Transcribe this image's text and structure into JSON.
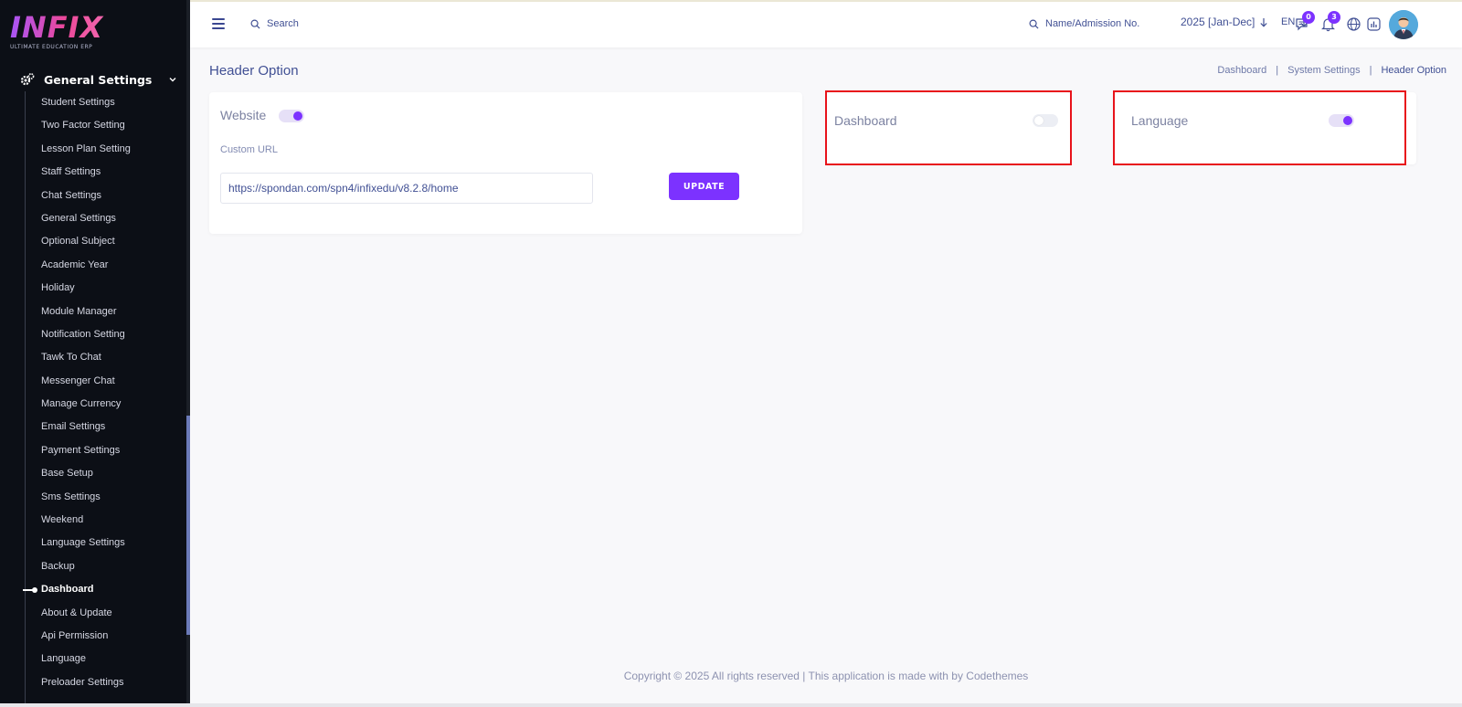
{
  "brand": {
    "logo_text": "INFIX",
    "logo_subtitle": "ULTIMATE EDUCATION ERP"
  },
  "sidebar": {
    "group_title": "General Settings",
    "items": [
      {
        "label": "Student Settings"
      },
      {
        "label": "Two Factor Setting"
      },
      {
        "label": "Lesson Plan Setting"
      },
      {
        "label": "Staff Settings"
      },
      {
        "label": "Chat Settings"
      },
      {
        "label": "General Settings"
      },
      {
        "label": "Optional Subject"
      },
      {
        "label": "Academic Year"
      },
      {
        "label": "Holiday"
      },
      {
        "label": "Module Manager"
      },
      {
        "label": "Notification Setting"
      },
      {
        "label": "Tawk To Chat"
      },
      {
        "label": "Messenger Chat"
      },
      {
        "label": "Manage Currency"
      },
      {
        "label": "Email Settings"
      },
      {
        "label": "Payment Settings"
      },
      {
        "label": "Base Setup"
      },
      {
        "label": "Sms Settings"
      },
      {
        "label": "Weekend"
      },
      {
        "label": "Language Settings"
      },
      {
        "label": "Backup"
      },
      {
        "label": "Dashboard"
      },
      {
        "label": "About & Update"
      },
      {
        "label": "Api Permission"
      },
      {
        "label": "Language"
      },
      {
        "label": "Preloader Settings"
      }
    ],
    "active_item": "Dashboard"
  },
  "topbar": {
    "search_placeholder": "Search",
    "student_search_placeholder": "Name/Admission No.",
    "academic_year": "2025 [Jan-Dec]",
    "language": "EN",
    "messages_badge": "0",
    "notifications_badge": "3"
  },
  "page": {
    "title": "Header Option",
    "breadcrumb": [
      "Dashboard",
      "System Settings",
      "Header Option"
    ]
  },
  "website_card": {
    "label": "Website",
    "enabled": true,
    "custom_url_label": "Custom URL",
    "custom_url_value": "https://spondan.com/spn4/infixedu/v8.2.8/home",
    "update_label": "UPDATE"
  },
  "dashboard_card": {
    "label": "Dashboard",
    "enabled": false
  },
  "language_card": {
    "label": "Language",
    "enabled": true
  },
  "colors": {
    "accent": "#7c32ff",
    "highlight": "#e8131b",
    "text": "#415094",
    "sidebar": "#0c0f16"
  },
  "footer": {
    "text": "Copyright © 2025 All rights reserved | This application is made with by Codethemes"
  }
}
